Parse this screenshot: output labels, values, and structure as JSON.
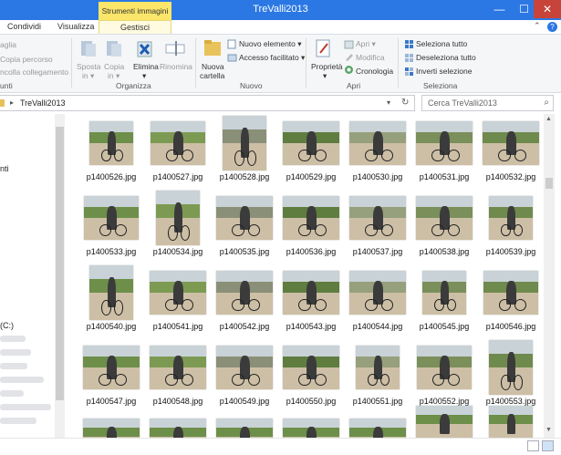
{
  "window": {
    "title": "TreValli2013",
    "minimize": "—",
    "maximize": "☐",
    "close": "✕"
  },
  "ribbon_tabs": {
    "context_header": "Strumenti immagini",
    "share": "Condividi",
    "view": "Visualizza",
    "manage": "Gestisci"
  },
  "ribbon": {
    "clipboard": {
      "paste_shortcut_partial": "aglia",
      "copy_path": "Copia percorso",
      "paste_link_partial": "ncolla collegamento",
      "group_label_partial": "unti"
    },
    "organize": {
      "move_to": "Sposta",
      "move_to_sub": "in ▾",
      "copy_to": "Copia",
      "copy_to_sub": "in ▾",
      "delete": "Elimina",
      "delete_sub": "▾",
      "rename": "Rinomina",
      "group_label": "Organizza"
    },
    "new": {
      "new_folder": "Nuova",
      "new_folder_sub": "cartella",
      "new_item": "Nuovo elemento ▾",
      "easy_access": "Accesso facilitato ▾",
      "group_label": "Nuovo"
    },
    "open": {
      "properties": "Proprietà",
      "properties_sub": "▾",
      "open": "Apri ▾",
      "edit": "Modifica",
      "history": "Cronologia",
      "group_label": "Apri"
    },
    "select": {
      "select_all": "Seleziona tutto",
      "select_none": "Deseleziona tutto",
      "invert": "Inverti selezione",
      "group_label": "Seleziona"
    }
  },
  "address": {
    "path": "TreValli2013",
    "search_placeholder": "Cerca TreValli2013"
  },
  "nav": {
    "item_partial": "nti",
    "drive": "(C:)"
  },
  "files": [
    "p1400526.jpg",
    "p1400527.jpg",
    "p1400528.jpg",
    "p1400529.jpg",
    "p1400530.jpg",
    "p1400531.jpg",
    "p1400532.jpg",
    "p1400533.jpg",
    "p1400534.jpg",
    "p1400535.jpg",
    "p1400536.jpg",
    "p1400537.jpg",
    "p1400538.jpg",
    "p1400539.jpg",
    "p1400540.jpg",
    "p1400541.jpg",
    "p1400542.jpg",
    "p1400543.jpg",
    "p1400544.jpg",
    "p1400545.jpg",
    "p1400546.jpg",
    "p1400547.jpg",
    "p1400548.jpg",
    "p1400549.jpg",
    "p1400550.jpg",
    "p1400551.jpg",
    "p1400552.jpg",
    "p1400553.jpg"
  ],
  "icons": {
    "folder": "folder-icon",
    "search": "search-icon",
    "refresh": "refresh-icon"
  }
}
